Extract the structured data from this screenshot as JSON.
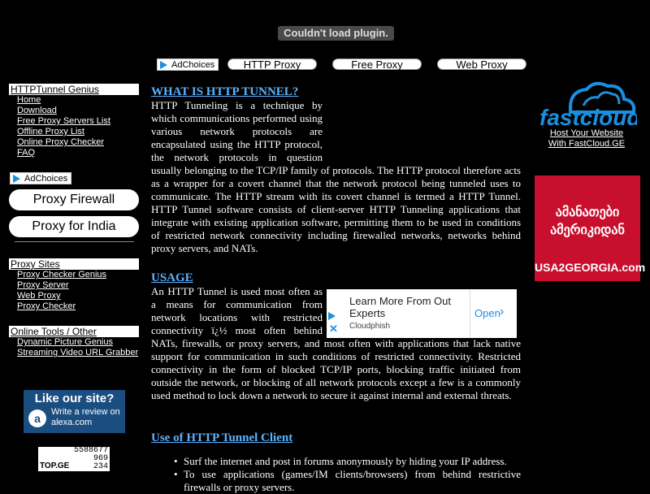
{
  "plugin_message": "Couldn't load plugin.",
  "adchoices_label": "AdChoices",
  "top_nav": [
    "HTTP Proxy",
    "Free Proxy",
    "Web Proxy"
  ],
  "sidebar": {
    "section1_title": "HTTPTunnel Genius",
    "section1_links": [
      "Home",
      "Download",
      "Free Proxy Servers List",
      "Offline Proxy List",
      "Online Proxy Checker",
      "FAQ"
    ],
    "big_buttons": [
      "Proxy Firewall",
      "Proxy for India"
    ],
    "section2_title": "Proxy Sites",
    "section2_links": [
      "Proxy Checker Genius",
      "Proxy Server",
      "Web Proxy",
      "Proxy Checker"
    ],
    "section3_title": "Online Tools / Other",
    "section3_links": [
      "Dynamic Picture Genius",
      "Streaming Video URL Grabber"
    ],
    "alexa_title": "Like our site?",
    "alexa_sub": "Write a review on alexa.com",
    "counter_values": [
      "5588677",
      "969",
      "234"
    ],
    "counter_label": "TOP.GE"
  },
  "main": {
    "heading1": "WHAT IS HTTP TUNNEL?",
    "para1": "HTTP Tunneling is a technique by which communications performed using various network protocols are encapsulated using the HTTP protocol, the network protocols in question usually belonging to the TCP/IP family of protocols. The HTTP protocol therefore acts as a wrapper for a covert channel that the network protocol being tunneled uses to communicate. The HTTP stream with its covert channel is termed a HTTP Tunnel. HTTP Tunnel software consists of client-server HTTP Tunneling applications that integrate with existing application software, permitting them to be used in conditions of restricted network connectivity including firewalled networks, networks behind proxy servers, and NATs.",
    "heading2": "USAGE",
    "para2": "An HTTP Tunnel is used most often as a means for communication from network locations with restricted connectivity ï¿½ most often behind NATs, firewalls, or proxy servers, and most often with applications that lack native support for communication in such conditions of restricted connectivity. Restricted connectivity in the form of blocked TCP/IP ports, blocking traffic initiated from outside the network, or blocking of all network protocols except a few is a commonly used method to lock down a network to secure it against internal and external threats.",
    "heading3": "Use of HTTP Tunnel Client",
    "bullets": [
      "Surf the internet and post in forums anonymously by hiding your IP address.",
      "To use applications (games/IM clients/browsers) from behind restrictive firewalls or proxy servers."
    ]
  },
  "ad": {
    "title": "Learn More From Out Experts",
    "source": "Cloudphish",
    "cta": "Open"
  },
  "right": {
    "fastcloud_logo": "fastcloud",
    "fastcloud_text1": "Host Your Website",
    "fastcloud_text2": "With FastCloud.GE",
    "usa_line1": "ამანათები",
    "usa_line2": "ამერიკიდან",
    "usa_site": "USA2GEORGIA.com"
  },
  "colors": {
    "link_blue": "#5ab4ff",
    "usa_red": "#c8102e",
    "fastcloud_blue": "#1a8fe0"
  }
}
